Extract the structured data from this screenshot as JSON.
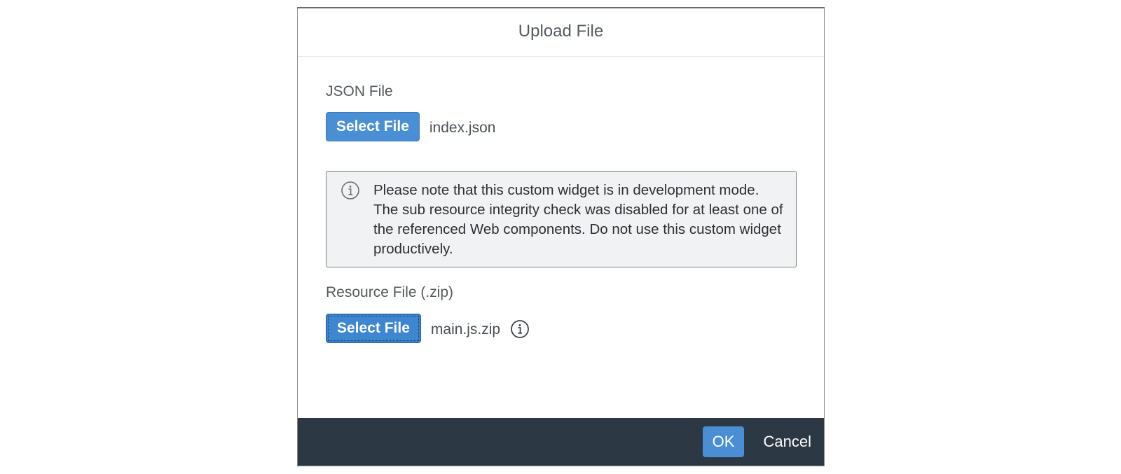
{
  "dialog": {
    "title": "Upload File"
  },
  "json_file": {
    "label": "JSON File",
    "button_label": "Select File",
    "file_name": "index.json"
  },
  "message": {
    "icon": "information-icon",
    "text": "Please note that this custom widget is in development mode. The sub resource integrity check was disabled for at least one of the referenced Web components. Do not use this custom widget productively."
  },
  "resource_file": {
    "label": "Resource File (.zip)",
    "button_label": "Select File",
    "file_name": "main.js.zip",
    "icon": "information-icon"
  },
  "footer": {
    "ok_label": "OK",
    "cancel_label": "Cancel"
  },
  "colors": {
    "accent": "#4a8fd4",
    "footer_bg": "#2d3845",
    "message_bg": "#f1f2f3"
  }
}
